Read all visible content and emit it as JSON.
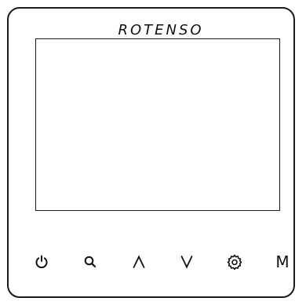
{
  "brand": {
    "name": "ROTENSO",
    "logo_icon": "rotenso-wordmark"
  },
  "display": {
    "state": "blank"
  },
  "buttons": [
    {
      "id": "power",
      "icon": "power-icon",
      "label": ""
    },
    {
      "id": "search",
      "icon": "search-icon",
      "label": ""
    },
    {
      "id": "up",
      "icon": "chevron-up-icon",
      "label": ""
    },
    {
      "id": "down",
      "icon": "chevron-down-icon",
      "label": ""
    },
    {
      "id": "settings",
      "icon": "gear-icon",
      "label": ""
    },
    {
      "id": "mode",
      "icon": "",
      "label": "M"
    }
  ],
  "colors": {
    "outline": "#1a1a1a",
    "background": "#ffffff"
  }
}
